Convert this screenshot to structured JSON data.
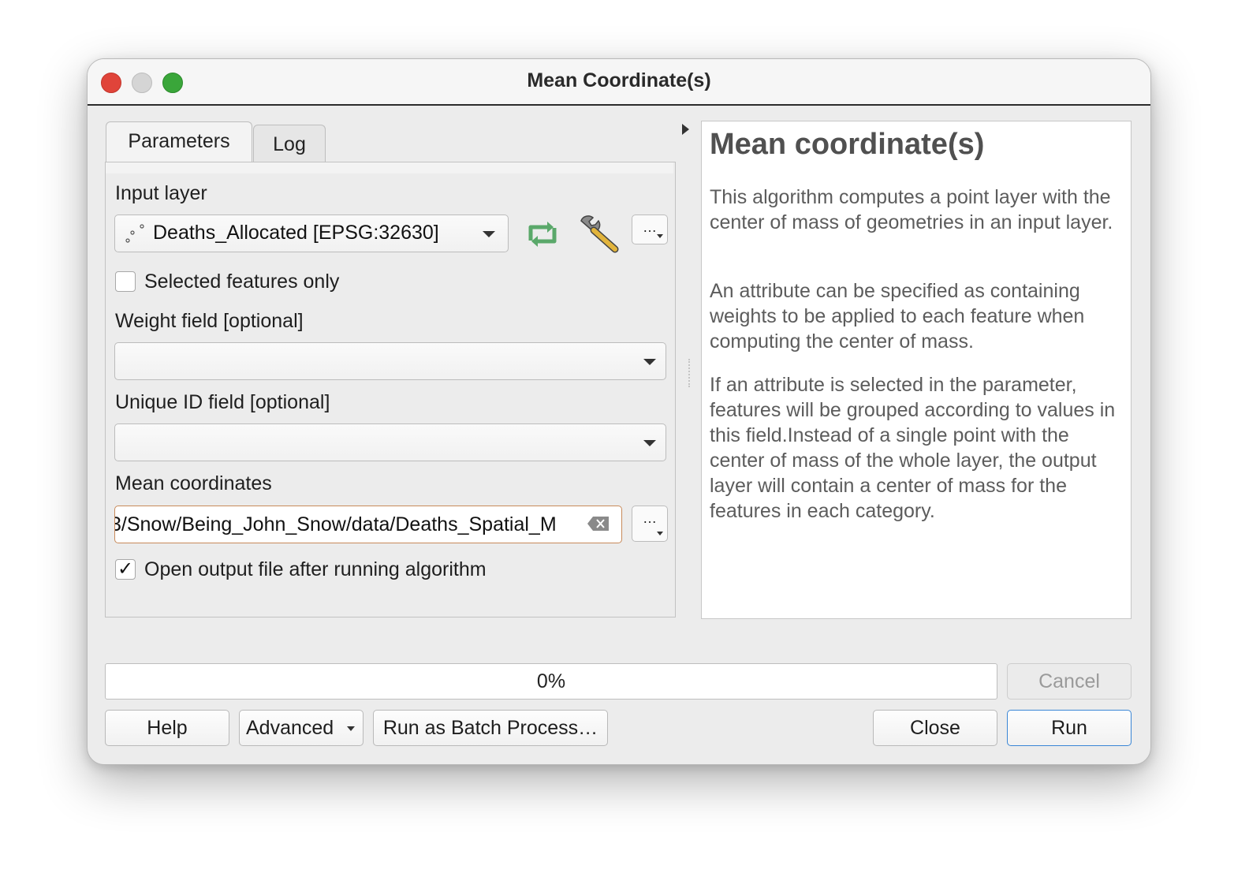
{
  "window": {
    "title": "Mean Coordinate(s)"
  },
  "tabs": [
    {
      "label": "Parameters",
      "active": true
    },
    {
      "label": "Log",
      "active": false
    }
  ],
  "params": {
    "input_layer_label": "Input layer",
    "input_layer_value": "Deaths_Allocated [EPSG:32630]",
    "ellipsis": "…",
    "selected_only_label": "Selected features only",
    "selected_only_checked": false,
    "weight_label": "Weight field [optional]",
    "weight_value": "",
    "uid_label": "Unique ID field [optional]",
    "uid_value": "",
    "mean_label": "Mean coordinates",
    "mean_value": "3/Snow/Being_John_Snow/data/Deaths_Spatial_M",
    "open_output_label": "Open output file after running algorithm",
    "open_output_mark": "✓"
  },
  "help": {
    "title": "Mean coordinate(s)",
    "p1": "This algorithm computes a point layer with the center of mass of geometries in an input layer.",
    "p2": "An attribute can be specified as containing weights to be applied to each feature when computing the center of mass.",
    "p3": "If an attribute is selected in the parameter, features will be grouped according to values in this field.Instead of a single point with the center of mass of the whole layer, the output layer will contain a center of mass for the features in each category."
  },
  "progress": {
    "text": "0%",
    "value": 0
  },
  "buttons": {
    "cancel": "Cancel",
    "help": "Help",
    "advanced": "Advanced",
    "batch": "Run as Batch Process…",
    "close": "Close",
    "run": "Run"
  },
  "colors": {
    "accent": "#3a86d6",
    "refresh_icon": "#5aa86a",
    "close_light": "#e0443a",
    "zoom_light": "#3aa63a"
  },
  "icons": [
    "point-layer-icon",
    "refresh-icon",
    "wrench-icon",
    "clear-icon",
    "collapse-arrow-icon"
  ]
}
